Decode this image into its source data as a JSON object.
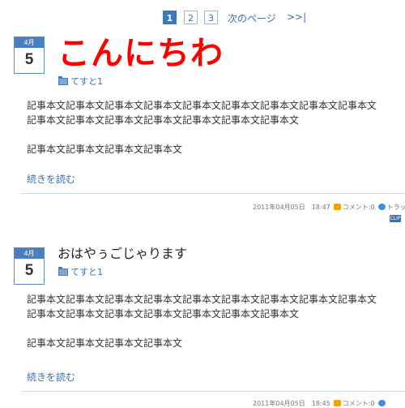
{
  "pager": {
    "pages": [
      "1",
      "2",
      "3"
    ],
    "next_label": "次のページ",
    "last_label": ">>|"
  },
  "posts": [
    {
      "month": "4月",
      "day": "5",
      "title": "こんにちわ",
      "category": "てすと1",
      "lines": [
        "記事本文記事本文記事本文記事本文記事本文記事本文記事本文記事本文記事本文",
        "記事本文記事本文記事本文記事本文記事本文記事本文記事本文",
        "",
        "記事本文記事本文記事本文記事本文"
      ],
      "more": "続きを読む",
      "datetime": "2011年04月05日　18:47",
      "comment": "コメント:0",
      "trackback": "トラッ"
    },
    {
      "month": "4月",
      "day": "5",
      "title": "おはやぅごじゃります",
      "category": "てすと1",
      "lines": [
        "記事本文記事本文記事本文記事本文記事本文記事本文記事本文記事本文記事本文",
        "記事本文記事本文記事本文記事本文記事本文記事本文記事本文",
        "",
        "記事本文記事本文記事本文記事本文"
      ],
      "more": "続きを読む",
      "datetime": "2011年04月05日　18:45",
      "comment": "コメント:0",
      "trackback": ""
    }
  ],
  "clip": "CLIP",
  "colors": {
    "accent": "#3a78c4",
    "title_red": "#ff0000",
    "link": "#3a6fb0"
  }
}
